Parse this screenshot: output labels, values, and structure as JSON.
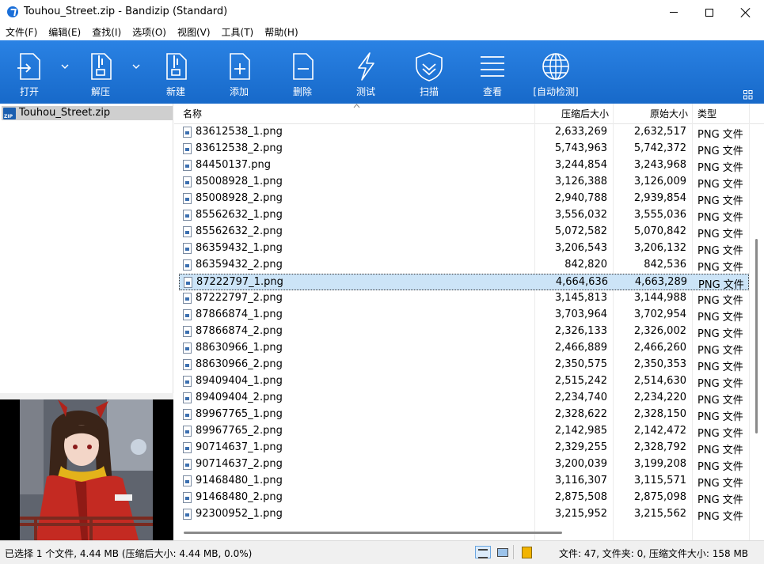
{
  "window": {
    "title": "Touhou_Street.zip - Bandizip (Standard)"
  },
  "menu": [
    "文件(F)",
    "编辑(E)",
    "查找(I)",
    "选项(O)",
    "视图(V)",
    "工具(T)",
    "帮助(H)"
  ],
  "toolbar": {
    "open": "打开",
    "extract": "解压",
    "new": "新建",
    "add": "添加",
    "delete": "删除",
    "test": "测试",
    "scan": "扫描",
    "view": "查看",
    "autocheck": "[自动检测]"
  },
  "tree": {
    "root": "Touhou_Street.zip"
  },
  "columns": {
    "name": "名称",
    "compressed": "压缩后大小",
    "original": "原始大小",
    "type": "类型"
  },
  "files": [
    {
      "name": "83612538_1.png",
      "compressed": "2,633,269",
      "original": "2,632,517",
      "type": "PNG 文件"
    },
    {
      "name": "83612538_2.png",
      "compressed": "5,743,963",
      "original": "5,742,372",
      "type": "PNG 文件"
    },
    {
      "name": "84450137.png",
      "compressed": "3,244,854",
      "original": "3,243,968",
      "type": "PNG 文件"
    },
    {
      "name": "85008928_1.png",
      "compressed": "3,126,388",
      "original": "3,126,009",
      "type": "PNG 文件"
    },
    {
      "name": "85008928_2.png",
      "compressed": "2,940,788",
      "original": "2,939,854",
      "type": "PNG 文件"
    },
    {
      "name": "85562632_1.png",
      "compressed": "3,556,032",
      "original": "3,555,036",
      "type": "PNG 文件"
    },
    {
      "name": "85562632_2.png",
      "compressed": "5,072,582",
      "original": "5,070,842",
      "type": "PNG 文件"
    },
    {
      "name": "86359432_1.png",
      "compressed": "3,206,543",
      "original": "3,206,132",
      "type": "PNG 文件"
    },
    {
      "name": "86359432_2.png",
      "compressed": "842,820",
      "original": "842,536",
      "type": "PNG 文件"
    },
    {
      "name": "87222797_1.png",
      "compressed": "4,664,636",
      "original": "4,663,289",
      "type": "PNG 文件"
    },
    {
      "name": "87222797_2.png",
      "compressed": "3,145,813",
      "original": "3,144,988",
      "type": "PNG 文件"
    },
    {
      "name": "87866874_1.png",
      "compressed": "3,703,964",
      "original": "3,702,954",
      "type": "PNG 文件"
    },
    {
      "name": "87866874_2.png",
      "compressed": "2,326,133",
      "original": "2,326,002",
      "type": "PNG 文件"
    },
    {
      "name": "88630966_1.png",
      "compressed": "2,466,889",
      "original": "2,466,260",
      "type": "PNG 文件"
    },
    {
      "name": "88630966_2.png",
      "compressed": "2,350,575",
      "original": "2,350,353",
      "type": "PNG 文件"
    },
    {
      "name": "89409404_1.png",
      "compressed": "2,515,242",
      "original": "2,514,630",
      "type": "PNG 文件"
    },
    {
      "name": "89409404_2.png",
      "compressed": "2,234,740",
      "original": "2,234,220",
      "type": "PNG 文件"
    },
    {
      "name": "89967765_1.png",
      "compressed": "2,328,622",
      "original": "2,328,150",
      "type": "PNG 文件"
    },
    {
      "name": "89967765_2.png",
      "compressed": "2,142,985",
      "original": "2,142,472",
      "type": "PNG 文件"
    },
    {
      "name": "90714637_1.png",
      "compressed": "2,329,255",
      "original": "2,328,792",
      "type": "PNG 文件"
    },
    {
      "name": "90714637_2.png",
      "compressed": "3,200,039",
      "original": "3,199,208",
      "type": "PNG 文件"
    },
    {
      "name": "91468480_1.png",
      "compressed": "3,116,307",
      "original": "3,115,571",
      "type": "PNG 文件"
    },
    {
      "name": "91468480_2.png",
      "compressed": "2,875,508",
      "original": "2,875,098",
      "type": "PNG 文件"
    },
    {
      "name": "92300952_1.png",
      "compressed": "3,215,952",
      "original": "3,215,562",
      "type": "PNG 文件"
    }
  ],
  "selected_file": "87222797_1.png",
  "status": {
    "selection": "已选择 1 个文件, 4.44 MB (压缩后大小: 4.44 MB, 0.0%)",
    "summary": "文件: 47, 文件夹: 0, 压缩文件大小: 158 MB"
  },
  "colors": {
    "toolbar": "#1b74d9",
    "selection": "#cce4f7"
  }
}
